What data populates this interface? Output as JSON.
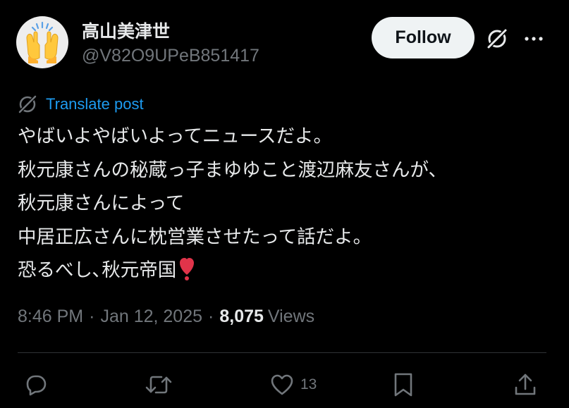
{
  "user": {
    "display_name": "高山美津世",
    "handle": "@V82O9UPeB851417",
    "avatar": "raising-hands-emoji-avatar"
  },
  "header": {
    "follow_label": "Follow",
    "grok_icon": "grok-icon",
    "more_icon": "more-icon"
  },
  "translate": {
    "label": "Translate post",
    "icon": "translate-icon"
  },
  "post": {
    "lines": [
      "やばいよやばいよってニュースだよ。",
      "秋元康さんの秘蔵っ子まゆゆこと渡辺麻友さんが、",
      "秋元康さんによって",
      "中居正広さんに枕営業させたって話だよ。",
      "恐るべし､秋元帝国"
    ],
    "emoji": "heavy-exclamation-mark-emoji"
  },
  "meta": {
    "time": "8:46 PM",
    "separator": "·",
    "date": "Jan 12, 2025",
    "views_count": "8,075",
    "views_label": "Views"
  },
  "actions": {
    "reply_icon": "reply-icon",
    "repost_icon": "repost-icon",
    "like_icon": "like-icon",
    "like_count": "13",
    "bookmark_icon": "bookmark-icon",
    "share_icon": "share-icon"
  },
  "colors": {
    "background": "#000000",
    "text": "#e7e9ea",
    "secondary": "#71767b",
    "link": "#1d9bf0",
    "button_bg": "#eff3f4",
    "divider": "#2f3336",
    "emoji_red": "#e0344a"
  }
}
